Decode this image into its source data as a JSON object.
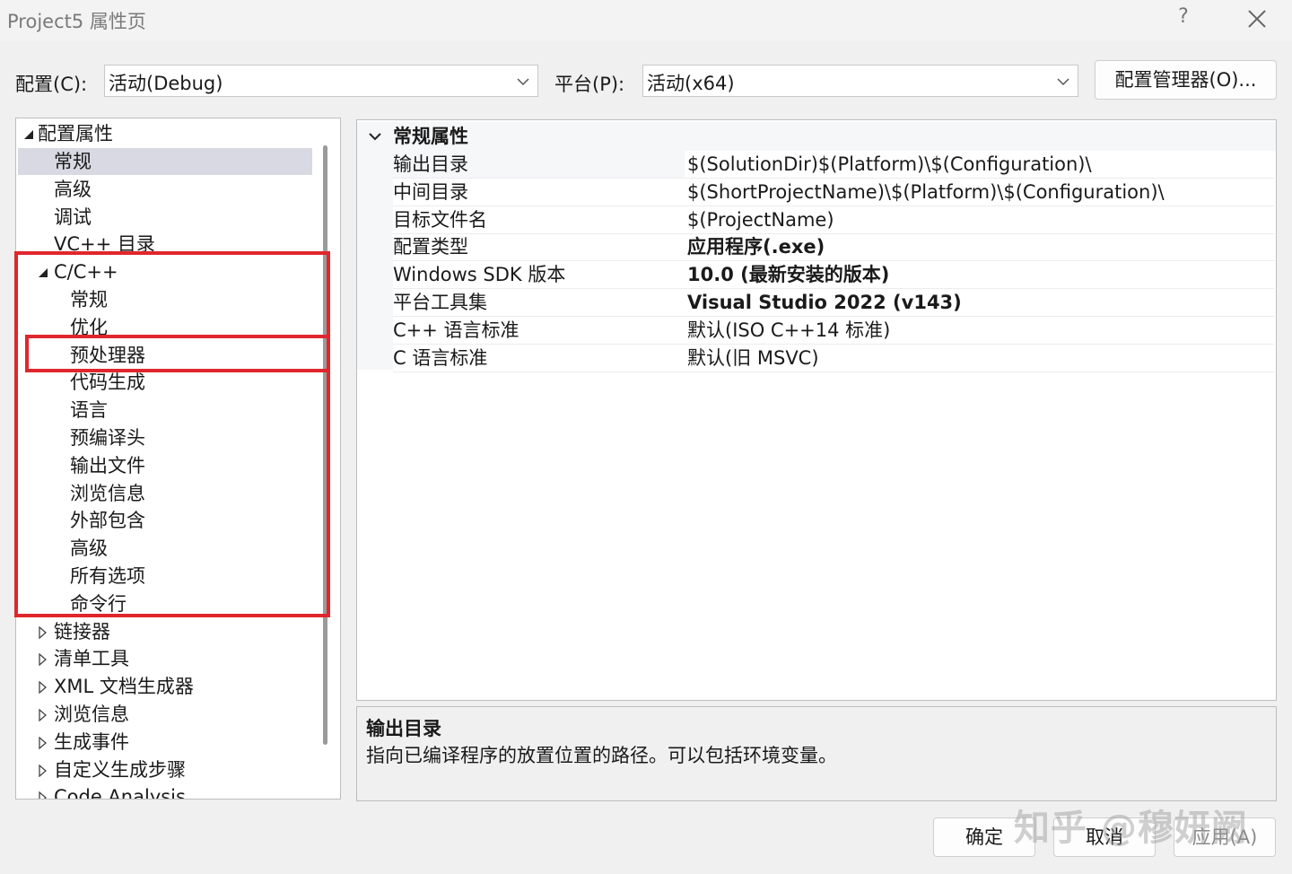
{
  "window": {
    "title": "Project5 属性页",
    "help_label": "?",
    "close_icon": "close-icon"
  },
  "toolbar": {
    "config_label": "配置(C):",
    "config_value": "活动(Debug)",
    "platform_label": "平台(P):",
    "platform_value": "活动(x64)",
    "config_manager_label": "配置管理器(O)..."
  },
  "tree": {
    "root": "配置属性",
    "items": [
      {
        "label": "常规",
        "selected": true
      },
      {
        "label": "高级"
      },
      {
        "label": "调试"
      },
      {
        "label": "VC++ 目录"
      },
      {
        "label": "C/C++",
        "expanded": true
      },
      {
        "label": "常规"
      },
      {
        "label": "优化"
      },
      {
        "label": "预处理器"
      },
      {
        "label": "代码生成"
      },
      {
        "label": "语言"
      },
      {
        "label": "预编译头"
      },
      {
        "label": "输出文件"
      },
      {
        "label": "浏览信息"
      },
      {
        "label": "外部包含"
      },
      {
        "label": "高级"
      },
      {
        "label": "所有选项"
      },
      {
        "label": "命令行"
      },
      {
        "label": "链接器"
      },
      {
        "label": "清单工具"
      },
      {
        "label": "XML 文档生成器"
      },
      {
        "label": "浏览信息"
      },
      {
        "label": "生成事件"
      },
      {
        "label": "自定义生成步骤"
      },
      {
        "label": "Code Analysis"
      }
    ]
  },
  "grid": {
    "section": "常规属性",
    "rows": [
      {
        "name": "输出目录",
        "value": "$(SolutionDir)$(Platform)\\$(Configuration)\\",
        "bold": false
      },
      {
        "name": "中间目录",
        "value": "$(ShortProjectName)\\$(Platform)\\$(Configuration)\\",
        "bold": false
      },
      {
        "name": "目标文件名",
        "value": "$(ProjectName)",
        "bold": false
      },
      {
        "name": "配置类型",
        "value": "应用程序(.exe)",
        "bold": true
      },
      {
        "name": "Windows SDK 版本",
        "value": "10.0 (最新安装的版本)",
        "bold": true
      },
      {
        "name": "平台工具集",
        "value": "Visual Studio 2022 (v143)",
        "bold": true
      },
      {
        "name": "C++ 语言标准",
        "value": "默认(ISO C++14 标准)",
        "bold": false
      },
      {
        "name": "C 语言标准",
        "value": "默认(旧 MSVC)",
        "bold": false
      }
    ]
  },
  "description": {
    "title": "输出目录",
    "text": "指向已编译程序的放置位置的路径。可以包括环境变量。"
  },
  "buttons": {
    "ok": "确定",
    "cancel": "取消",
    "apply": "应用(A)"
  },
  "watermark": "知乎 @穆妍阙",
  "colors": {
    "highlight_box": "#e0262c",
    "selected_row": "#d9d9e3"
  }
}
